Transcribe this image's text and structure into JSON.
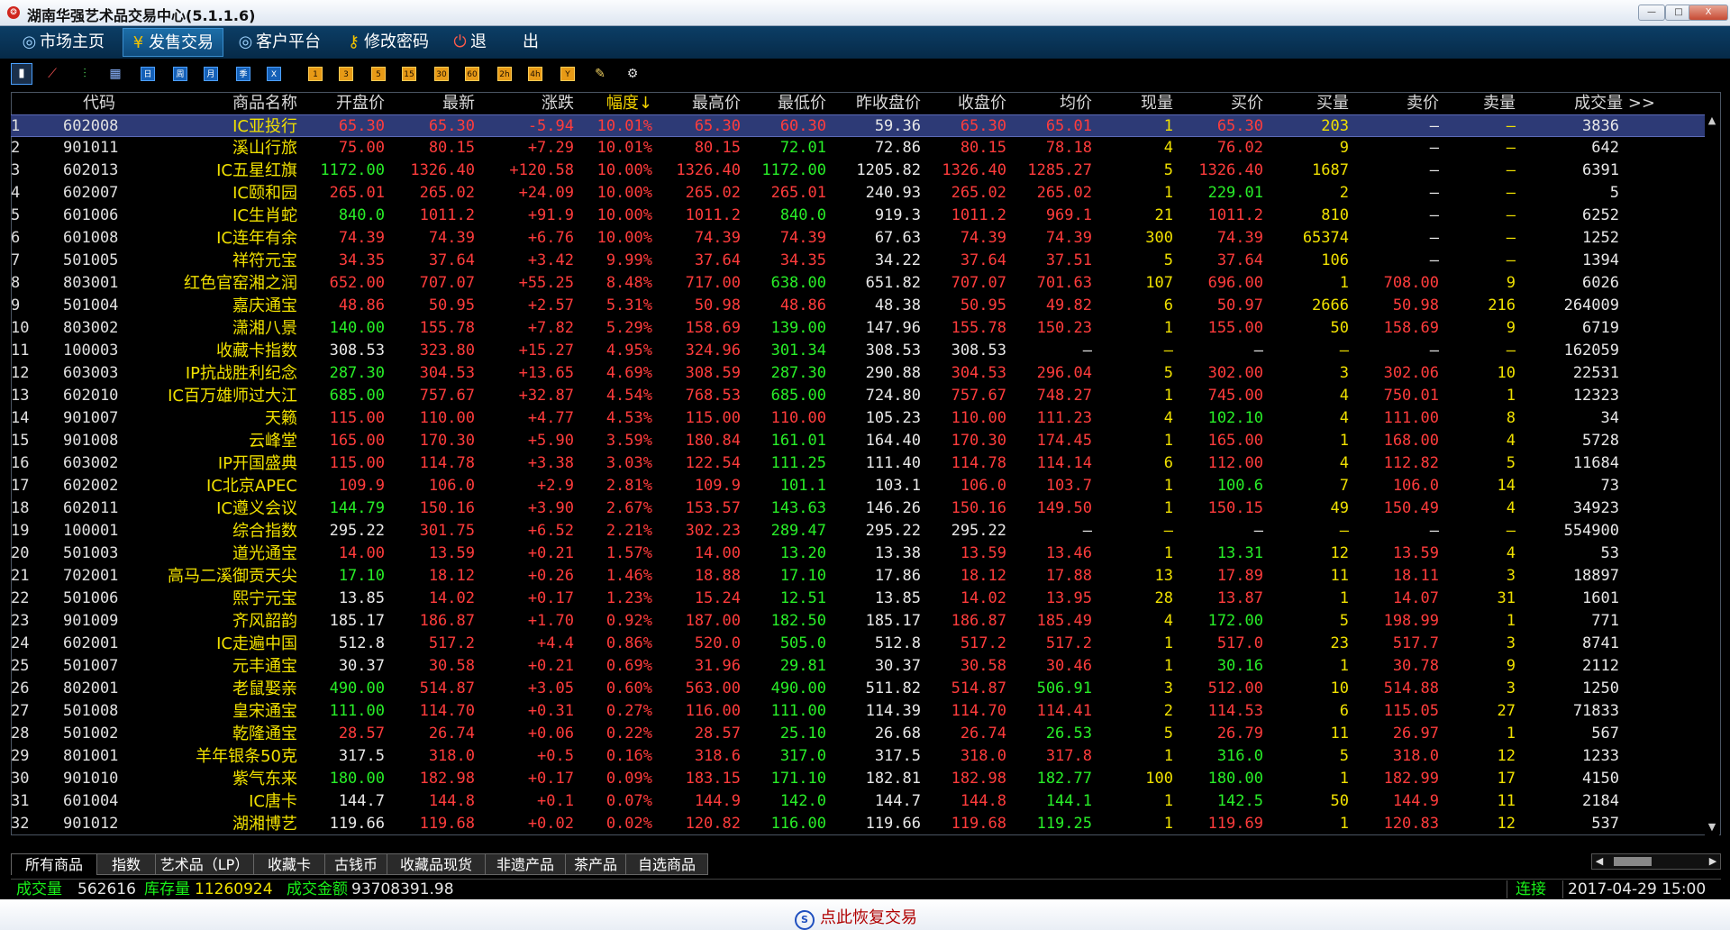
{
  "window": {
    "title": "湖南华强艺术品交易中心(5.1.1.6)",
    "minimize_label": "—",
    "maximize_label": "□",
    "close_label": "X"
  },
  "menu": [
    {
      "label": "市场主页",
      "icon": "globe-icon",
      "active": false
    },
    {
      "label": "发售交易",
      "icon": "yen-icon",
      "active": true
    },
    {
      "label": "客户平台",
      "icon": "globe-icon",
      "active": false
    },
    {
      "label": "修改密码",
      "icon": "key-icon",
      "active": false
    },
    {
      "label": "退",
      "icon": "power-icon",
      "active": false
    },
    {
      "label": "出",
      "icon": "",
      "active": false
    }
  ],
  "toolbar": {
    "chart_buttons": [
      {
        "icon": "bar-chart-icon",
        "glyph": "▮"
      },
      {
        "icon": "line-chart-icon",
        "glyph": "⟋"
      },
      {
        "icon": "candlestick-icon",
        "glyph": "⫶"
      },
      {
        "icon": "calendar-icon",
        "glyph": "▦"
      }
    ],
    "period_buttons": [
      "日",
      "周",
      "月",
      "季",
      "X"
    ],
    "minute_buttons": [
      "1",
      "3",
      "5",
      "15",
      "30",
      "60",
      "2h",
      "4h",
      "Y"
    ],
    "tool_buttons": [
      {
        "icon": "pencil-icon",
        "glyph": "✎"
      },
      {
        "icon": "gear-icon",
        "glyph": "⚙"
      }
    ]
  },
  "table": {
    "columns": [
      "代码",
      "商品名称",
      "开盘价",
      "最新",
      "涨跌",
      "幅度↓",
      "最高价",
      "最低价",
      "昨收盘价",
      "收盘价",
      "均价",
      "现量",
      "买价",
      "买量",
      "卖价",
      "卖量",
      "成交量 >>"
    ],
    "rows": [
      [
        "1",
        "602008",
        "IC亚投行",
        "65.30",
        "65.30",
        "-5.94",
        "10.01%",
        "65.30",
        "60.30",
        "59.36",
        "65.30",
        "65.01",
        "1",
        "65.30",
        "203",
        "—",
        "—",
        "3836"
      ],
      [
        "2",
        "901011",
        "溪山行旅",
        "75.00",
        "80.15",
        "+7.29",
        "10.01%",
        "80.15",
        "72.01",
        "72.86",
        "80.15",
        "78.18",
        "4",
        "76.02",
        "9",
        "—",
        "—",
        "642"
      ],
      [
        "3",
        "602013",
        "IC五星红旗",
        "1172.00",
        "1326.40",
        "+120.58",
        "10.00%",
        "1326.40",
        "1172.00",
        "1205.82",
        "1326.40",
        "1285.27",
        "5",
        "1326.40",
        "1687",
        "—",
        "—",
        "6391"
      ],
      [
        "4",
        "602007",
        "IC颐和园",
        "265.01",
        "265.02",
        "+24.09",
        "10.00%",
        "265.02",
        "265.01",
        "240.93",
        "265.02",
        "265.02",
        "1",
        "229.01",
        "2",
        "—",
        "—",
        "5"
      ],
      [
        "5",
        "601006",
        "IC生肖蛇",
        "840.0",
        "1011.2",
        "+91.9",
        "10.00%",
        "1011.2",
        "840.0",
        "919.3",
        "1011.2",
        "969.1",
        "21",
        "1011.2",
        "810",
        "—",
        "—",
        "6252"
      ],
      [
        "6",
        "601008",
        "IC连年有余",
        "74.39",
        "74.39",
        "+6.76",
        "10.00%",
        "74.39",
        "74.39",
        "67.63",
        "74.39",
        "74.39",
        "300",
        "74.39",
        "65374",
        "—",
        "—",
        "1252"
      ],
      [
        "7",
        "501005",
        "祥符元宝",
        "34.35",
        "37.64",
        "+3.42",
        "9.99%",
        "37.64",
        "34.35",
        "34.22",
        "37.64",
        "37.51",
        "5",
        "37.64",
        "106",
        "—",
        "—",
        "1394"
      ],
      [
        "8",
        "803001",
        "红色官窑湘之润",
        "652.00",
        "707.07",
        "+55.25",
        "8.48%",
        "717.00",
        "638.00",
        "651.82",
        "707.07",
        "701.63",
        "107",
        "696.00",
        "1",
        "708.00",
        "9",
        "6026"
      ],
      [
        "9",
        "501004",
        "嘉庆通宝",
        "48.86",
        "50.95",
        "+2.57",
        "5.31%",
        "50.98",
        "48.86",
        "48.38",
        "50.95",
        "49.82",
        "6",
        "50.97",
        "2666",
        "50.98",
        "216",
        "264009"
      ],
      [
        "10",
        "803002",
        "潇湘八景",
        "140.00",
        "155.78",
        "+7.82",
        "5.29%",
        "158.69",
        "139.00",
        "147.96",
        "155.78",
        "150.23",
        "1",
        "155.00",
        "50",
        "158.69",
        "9",
        "6719"
      ],
      [
        "11",
        "100003",
        "收藏卡指数",
        "308.53",
        "323.80",
        "+15.27",
        "4.95%",
        "324.96",
        "301.34",
        "308.53",
        "308.53",
        "—",
        "—",
        "—",
        "—",
        "—",
        "—",
        "162059"
      ],
      [
        "12",
        "603003",
        "IP抗战胜利纪念",
        "287.30",
        "304.53",
        "+13.65",
        "4.69%",
        "308.59",
        "287.30",
        "290.88",
        "304.53",
        "296.04",
        "5",
        "302.00",
        "3",
        "302.06",
        "10",
        "22531"
      ],
      [
        "13",
        "602010",
        "IC百万雄师过大江",
        "685.00",
        "757.67",
        "+32.87",
        "4.54%",
        "768.53",
        "685.00",
        "724.80",
        "757.67",
        "748.27",
        "1",
        "745.00",
        "4",
        "750.01",
        "1",
        "12323"
      ],
      [
        "14",
        "901007",
        "天籁",
        "115.00",
        "110.00",
        "+4.77",
        "4.53%",
        "115.00",
        "110.00",
        "105.23",
        "110.00",
        "111.23",
        "4",
        "102.10",
        "4",
        "111.00",
        "8",
        "34"
      ],
      [
        "15",
        "901008",
        "云峰堂",
        "165.00",
        "170.30",
        "+5.90",
        "3.59%",
        "180.84",
        "161.01",
        "164.40",
        "170.30",
        "174.45",
        "1",
        "165.00",
        "1",
        "168.00",
        "4",
        "5728"
      ],
      [
        "16",
        "603002",
        "IP开国盛典",
        "115.00",
        "114.78",
        "+3.38",
        "3.03%",
        "122.54",
        "111.25",
        "111.40",
        "114.78",
        "114.14",
        "6",
        "112.00",
        "4",
        "112.82",
        "5",
        "11684"
      ],
      [
        "17",
        "602002",
        "IC北京APEC",
        "109.9",
        "106.0",
        "+2.9",
        "2.81%",
        "109.9",
        "101.1",
        "103.1",
        "106.0",
        "103.7",
        "1",
        "100.6",
        "7",
        "106.0",
        "14",
        "73"
      ],
      [
        "18",
        "602011",
        "IC遵义会议",
        "144.79",
        "150.16",
        "+3.90",
        "2.67%",
        "153.57",
        "143.63",
        "146.26",
        "150.16",
        "149.50",
        "1",
        "150.15",
        "49",
        "150.49",
        "4",
        "34923"
      ],
      [
        "19",
        "100001",
        "综合指数",
        "295.22",
        "301.75",
        "+6.52",
        "2.21%",
        "302.23",
        "289.47",
        "295.22",
        "295.22",
        "—",
        "—",
        "—",
        "—",
        "—",
        "—",
        "554900"
      ],
      [
        "20",
        "501003",
        "道光通宝",
        "14.00",
        "13.59",
        "+0.21",
        "1.57%",
        "14.00",
        "13.20",
        "13.38",
        "13.59",
        "13.46",
        "1",
        "13.31",
        "12",
        "13.59",
        "4",
        "53"
      ],
      [
        "21",
        "702001",
        "高马二溪御贡天尖",
        "17.10",
        "18.12",
        "+0.26",
        "1.46%",
        "18.88",
        "17.10",
        "17.86",
        "18.12",
        "17.88",
        "13",
        "17.89",
        "11",
        "18.11",
        "3",
        "18897"
      ],
      [
        "22",
        "501006",
        "熙宁元宝",
        "13.85",
        "14.02",
        "+0.17",
        "1.23%",
        "15.24",
        "12.51",
        "13.85",
        "14.02",
        "13.95",
        "28",
        "13.87",
        "1",
        "14.07",
        "31",
        "1601"
      ],
      [
        "23",
        "901009",
        "齐风韶韵",
        "185.17",
        "186.87",
        "+1.70",
        "0.92%",
        "187.00",
        "182.50",
        "185.17",
        "186.87",
        "185.49",
        "4",
        "172.00",
        "5",
        "198.99",
        "1",
        "771"
      ],
      [
        "24",
        "602001",
        "IC走遍中国",
        "512.8",
        "517.2",
        "+4.4",
        "0.86%",
        "520.0",
        "505.0",
        "512.8",
        "517.2",
        "517.2",
        "1",
        "517.0",
        "23",
        "517.7",
        "3",
        "8741"
      ],
      [
        "25",
        "501007",
        "元丰通宝",
        "30.37",
        "30.58",
        "+0.21",
        "0.69%",
        "31.96",
        "29.81",
        "30.37",
        "30.58",
        "30.46",
        "1",
        "30.16",
        "1",
        "30.78",
        "9",
        "2112"
      ],
      [
        "26",
        "802001",
        "老鼠娶亲",
        "490.00",
        "514.87",
        "+3.05",
        "0.60%",
        "563.00",
        "490.00",
        "511.82",
        "514.87",
        "506.91",
        "3",
        "512.00",
        "10",
        "514.88",
        "3",
        "1250"
      ],
      [
        "27",
        "501008",
        "皇宋通宝",
        "111.00",
        "114.70",
        "+0.31",
        "0.27%",
        "116.00",
        "111.00",
        "114.39",
        "114.70",
        "114.41",
        "2",
        "114.53",
        "6",
        "115.05",
        "27",
        "71833"
      ],
      [
        "28",
        "501002",
        "乾隆通宝",
        "28.57",
        "26.74",
        "+0.06",
        "0.22%",
        "28.57",
        "25.10",
        "26.68",
        "26.74",
        "26.53",
        "5",
        "26.79",
        "11",
        "26.97",
        "1",
        "567"
      ],
      [
        "29",
        "801001",
        "羊年银条50克",
        "317.5",
        "318.0",
        "+0.5",
        "0.16%",
        "318.6",
        "317.0",
        "317.5",
        "318.0",
        "317.8",
        "1",
        "316.0",
        "5",
        "318.0",
        "12",
        "1233"
      ],
      [
        "30",
        "901010",
        "紫气东来",
        "180.00",
        "182.98",
        "+0.17",
        "0.09%",
        "183.15",
        "171.10",
        "182.81",
        "182.98",
        "182.77",
        "100",
        "180.00",
        "1",
        "182.99",
        "17",
        "4150"
      ],
      [
        "31",
        "601004",
        "IC唐卡",
        "144.7",
        "144.8",
        "+0.1",
        "0.07%",
        "144.9",
        "142.0",
        "144.7",
        "144.8",
        "144.1",
        "1",
        "142.5",
        "50",
        "144.9",
        "11",
        "2184"
      ],
      [
        "32",
        "901012",
        "湖湘博艺",
        "119.66",
        "119.68",
        "+0.02",
        "0.02%",
        "120.82",
        "116.00",
        "119.66",
        "119.68",
        "119.25",
        "1",
        "119.69",
        "1",
        "120.83",
        "12",
        "537"
      ]
    ]
  },
  "tabs": [
    "所有商品",
    "指数",
    "艺术品（LP）",
    "收藏卡",
    "古钱币",
    "收藏品现货",
    "非遗产品",
    "茶产品",
    "自选商品"
  ],
  "status": {
    "volume_label": "成交量",
    "volume_value": "562616",
    "stock_label": "库存量",
    "stock_value": "11260924",
    "amount_label": "成交金额",
    "amount_value": "93708391.98",
    "connection": "连接",
    "datetime": "2017-04-29 15:00"
  },
  "footer": {
    "restore_label": "点此恢复交易"
  },
  "colors": {
    "up": "#ff3c3c",
    "down": "#28ee28",
    "flat": "#e8e8e8",
    "name": "#f0e000",
    "selected_row": "#2d3a76"
  }
}
